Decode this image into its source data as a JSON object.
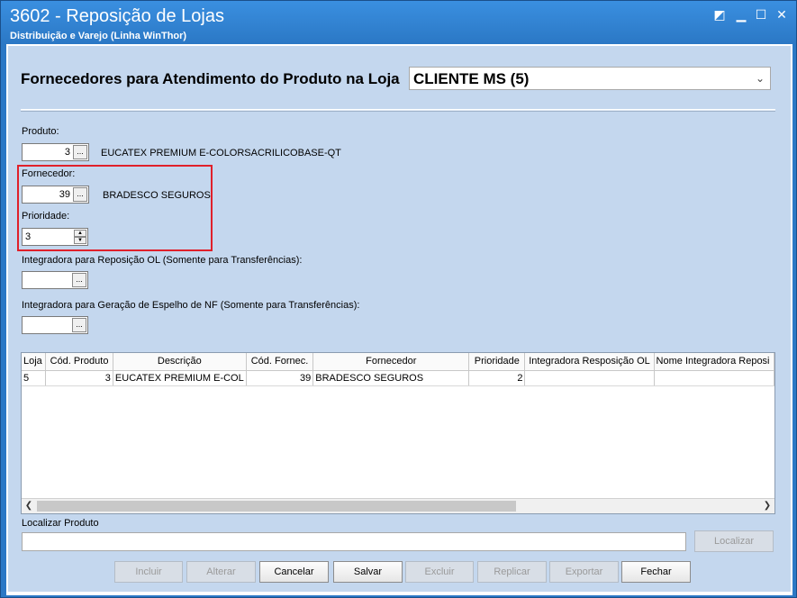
{
  "window": {
    "title": "3602 - Reposição de Lojas",
    "subtitle": "Distribuição e Varejo (Linha WinThor)",
    "controls": {
      "restore": "◩",
      "minimize": "▁",
      "maximize": "☐",
      "close": "✕"
    }
  },
  "header": {
    "label": "Fornecedores para Atendimento do Produto na Loja",
    "store_selected": "CLIENTE MS (5)"
  },
  "form": {
    "produto": {
      "label": "Produto:",
      "code": "3",
      "description": "EUCATEX PREMIUM E-COLORSACRILICOBASE-QT"
    },
    "fornecedor": {
      "label": "Fornecedor:",
      "code": "39",
      "description": "BRADESCO SEGUROS"
    },
    "prioridade": {
      "label": "Prioridade:",
      "value": "3"
    },
    "integradora_ol": {
      "label": "Integradora para Reposição OL (Somente para Transferências):",
      "value": ""
    },
    "integradora_nf": {
      "label": "Integradora para Geração de Espelho de NF  (Somente para Transferências):",
      "value": ""
    },
    "ellipsis": "..."
  },
  "grid": {
    "columns": [
      "Loja",
      "Cód. Produto",
      "Descrição",
      "Cód. Fornec.",
      "Fornecedor",
      "Prioridade",
      "Integradora Resposição OL",
      "Nome Integradora Reposi"
    ],
    "rows": [
      [
        "5",
        "3",
        "EUCATEX PREMIUM E-COL",
        "39",
        "BRADESCO SEGUROS",
        "2",
        "",
        ""
      ]
    ]
  },
  "search": {
    "label": "Localizar Produto",
    "value": "",
    "button": "Localizar"
  },
  "buttons": {
    "incluir": "Incluir",
    "alterar": "Alterar",
    "cancelar": "Cancelar",
    "salvar": "Salvar",
    "excluir": "Excluir",
    "replicar": "Replicar",
    "exportar": "Exportar",
    "fechar": "Fechar"
  },
  "colors": {
    "title_bar": "#2b78c5",
    "panel": "#c4d7ee",
    "highlight": "#e0202a"
  }
}
